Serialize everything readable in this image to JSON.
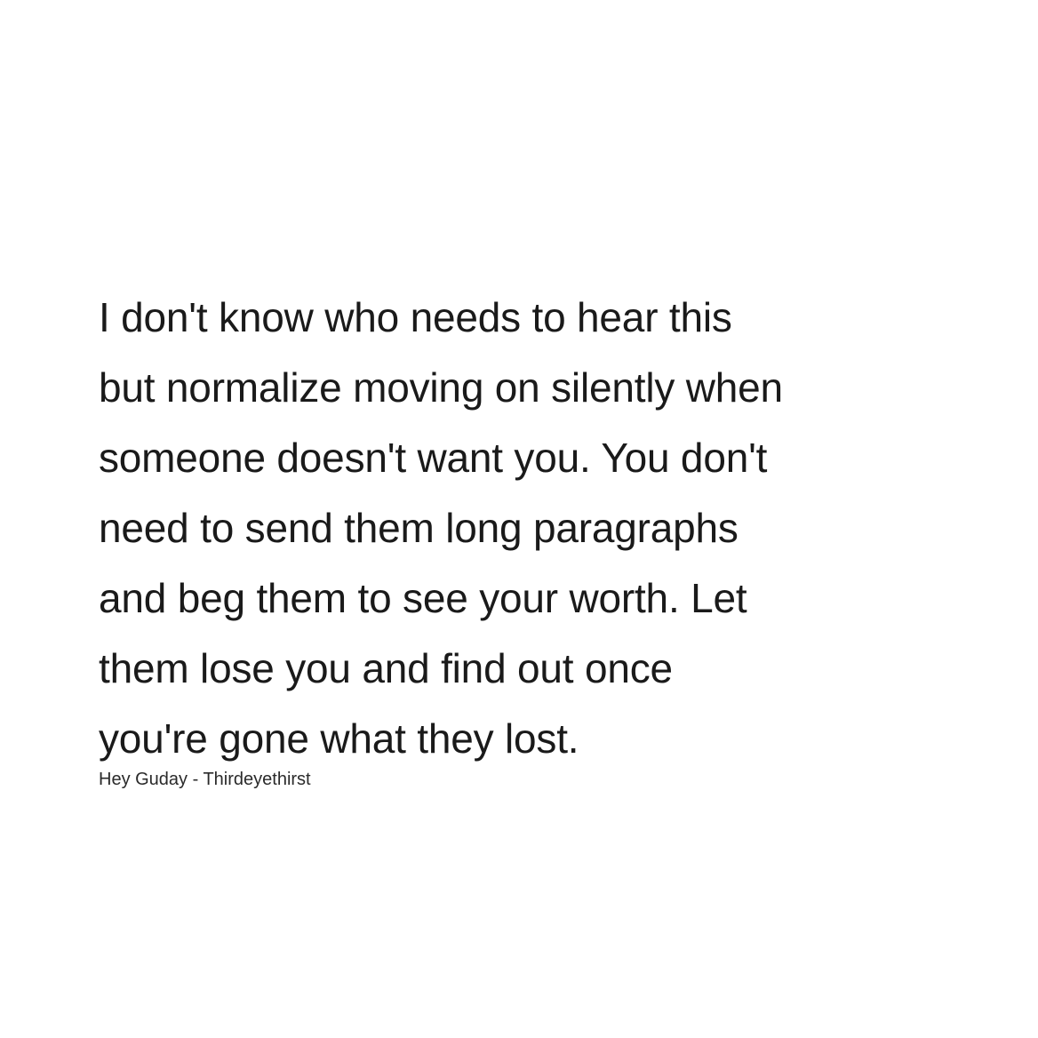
{
  "quote": {
    "lines": [
      "I don't know who needs to hear this",
      "but normalize moving on silently when",
      "someone doesn't want you. You don't",
      "need to send them long paragraphs",
      "and beg them to see your worth. Let",
      "them lose you and find out once",
      "you're gone what they lost."
    ],
    "attribution": "Hey Guday - Thirdeyethirst"
  }
}
